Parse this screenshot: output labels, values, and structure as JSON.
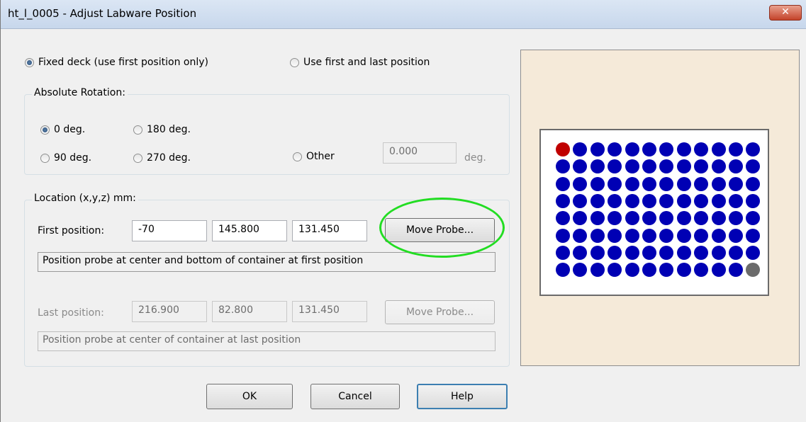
{
  "window": {
    "title": "ht_l_0005 - Adjust Labware Position",
    "close_glyph": "✕"
  },
  "mode": {
    "fixed_deck_label": "Fixed deck (use first position only)",
    "first_last_label": "Use first and last position",
    "selected": "fixed_deck"
  },
  "rotation": {
    "group_title": "Absolute Rotation:",
    "options": [
      "0 deg.",
      "180 deg.",
      "90 deg.",
      "270 deg.",
      "Other"
    ],
    "selected": "0 deg.",
    "other_value": "0.000",
    "other_unit": "deg."
  },
  "location": {
    "group_title": "Location (x,y,z) mm:",
    "first": {
      "label": "First position:",
      "x": "-70",
      "y": "145.800",
      "z": "131.450",
      "move_probe_label": "Move Probe...",
      "hint": "Position probe at center and bottom of container at first position"
    },
    "last": {
      "label": "Last position:",
      "x": "216.900",
      "y": "82.800",
      "z": "131.450",
      "move_probe_label": "Move Probe...",
      "hint": "Position probe at center of container at last position",
      "disabled": true
    }
  },
  "buttons": {
    "ok": "OK",
    "cancel": "Cancel",
    "help": "Help"
  },
  "plate_preview": {
    "rows": 8,
    "columns": 12,
    "well_color": "#0000b4",
    "first_well_color": "#c00000",
    "last_well_color": "#6b6b6b",
    "background_color": "#f5ead9"
  },
  "annotation": {
    "highlight_color": "#22dd22",
    "highlighted_element": "first-move-probe-button"
  }
}
